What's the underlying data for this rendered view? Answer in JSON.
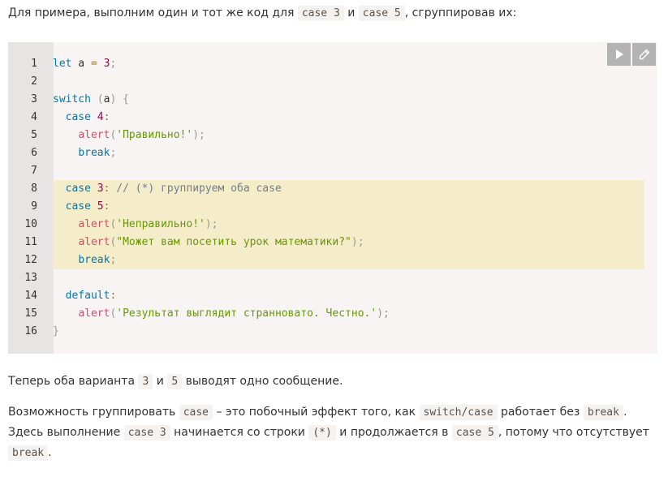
{
  "intro": {
    "text_before": "Для примера, выполним один и тот же код для ",
    "code_a": "case 3",
    "and": " и ",
    "code_b": "case 5",
    "text_after": ", сгруппировав их:"
  },
  "code": {
    "line_numbers": [
      "1",
      "2",
      "3",
      "4",
      "5",
      "6",
      "7",
      "8",
      "9",
      "10",
      "11",
      "12",
      "13",
      "14",
      "15",
      "16"
    ],
    "line1": {
      "kw": "let",
      "var": " a ",
      "op": "=",
      "sp": " ",
      "num": "3",
      "pn": ";"
    },
    "line3": {
      "kw": "switch",
      "sp": " ",
      "p1": "(",
      "var": "a",
      "p2": ")",
      "rest": " ",
      "p3": "{"
    },
    "line4": {
      "indent": "  ",
      "kw": "case",
      "sp": " ",
      "num": "4",
      "pn": ":"
    },
    "line5": {
      "indent": "    ",
      "fn": "alert",
      "p1": "(",
      "str": "'Правильно!'",
      "p2": ");"
    },
    "line6": {
      "indent": "    ",
      "kw": "break",
      "pn": ";"
    },
    "line8": {
      "indent": "  ",
      "kw": "case",
      "sp": " ",
      "num": "3",
      "pn": ":",
      "sp2": " ",
      "comment": "// (*) группируем оба case"
    },
    "line9": {
      "indent": "  ",
      "kw": "case",
      "sp": " ",
      "num": "5",
      "pn": ":"
    },
    "line10": {
      "indent": "    ",
      "fn": "alert",
      "p1": "(",
      "str": "'Неправильно!'",
      "p2": ");"
    },
    "line11": {
      "indent": "    ",
      "fn": "alert",
      "p1": "(",
      "str": "\"Может вам посетить урок математики?\"",
      "p2": ");"
    },
    "line12": {
      "indent": "    ",
      "kw": "break",
      "pn": ";"
    },
    "line14": {
      "indent": "  ",
      "kw": "default",
      "pn": ":"
    },
    "line15": {
      "indent": "    ",
      "fn": "alert",
      "p1": "(",
      "str": "'Результат выглядит странновато. Честно.'",
      "p2": ");"
    },
    "line16": {
      "p": "}"
    },
    "highlight_color": "#f5ecc9"
  },
  "toolbar": {
    "run_icon": "play-icon",
    "edit_icon": "pencil-icon"
  },
  "after1": {
    "t1": "Теперь оба варианта ",
    "c1": "3",
    "t2": " и ",
    "c2": "5",
    "t3": " выводят одно сообщение."
  },
  "after2": {
    "t1": "Возможность группировать ",
    "c1": "case",
    "t2": " – это побочный эффект того, как ",
    "c2": "switch/case",
    "t3": " работает без ",
    "c3": "break",
    "t4": ".",
    "t5": "Здесь выполнение ",
    "c4": "case 3",
    "t6": " начинается со строки ",
    "c5": "(*)",
    "t7": " и продолжается в ",
    "c6": "case 5",
    "t8": ", потому что отсутствует",
    "c7": "break",
    "t9": "."
  }
}
